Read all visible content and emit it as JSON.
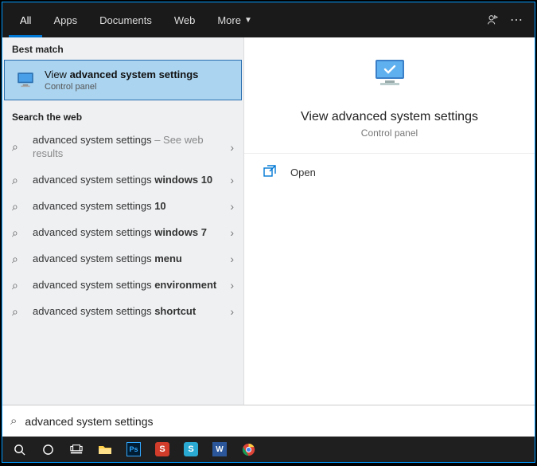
{
  "tabs": {
    "all": "All",
    "apps": "Apps",
    "documents": "Documents",
    "web": "Web",
    "more": "More"
  },
  "sections": {
    "best": "Best match",
    "web": "Search the web"
  },
  "bestMatch": {
    "prefix": "View ",
    "bold": "advanced system settings",
    "sub": "Control panel"
  },
  "web": [
    {
      "plain": "advanced system settings",
      "bold": "",
      "suffix": " – See web results"
    },
    {
      "plain": "advanced system settings ",
      "bold": "windows 10",
      "suffix": ""
    },
    {
      "plain": "advanced system settings ",
      "bold": "10",
      "suffix": ""
    },
    {
      "plain": "advanced system settings ",
      "bold": "windows 7",
      "suffix": ""
    },
    {
      "plain": "advanced system settings ",
      "bold": "menu",
      "suffix": ""
    },
    {
      "plain": "advanced system settings ",
      "bold": "environment",
      "suffix": ""
    },
    {
      "plain": "advanced system settings ",
      "bold": "shortcut",
      "suffix": ""
    }
  ],
  "detail": {
    "title": "View advanced system settings",
    "sub": "Control panel",
    "open": "Open"
  },
  "search": {
    "value": "advanced system settings"
  },
  "taskbar": {
    "items": [
      "search",
      "cortana",
      "taskview",
      "explorer",
      "photoshop",
      "s-app",
      "snagit",
      "word",
      "chrome"
    ]
  }
}
